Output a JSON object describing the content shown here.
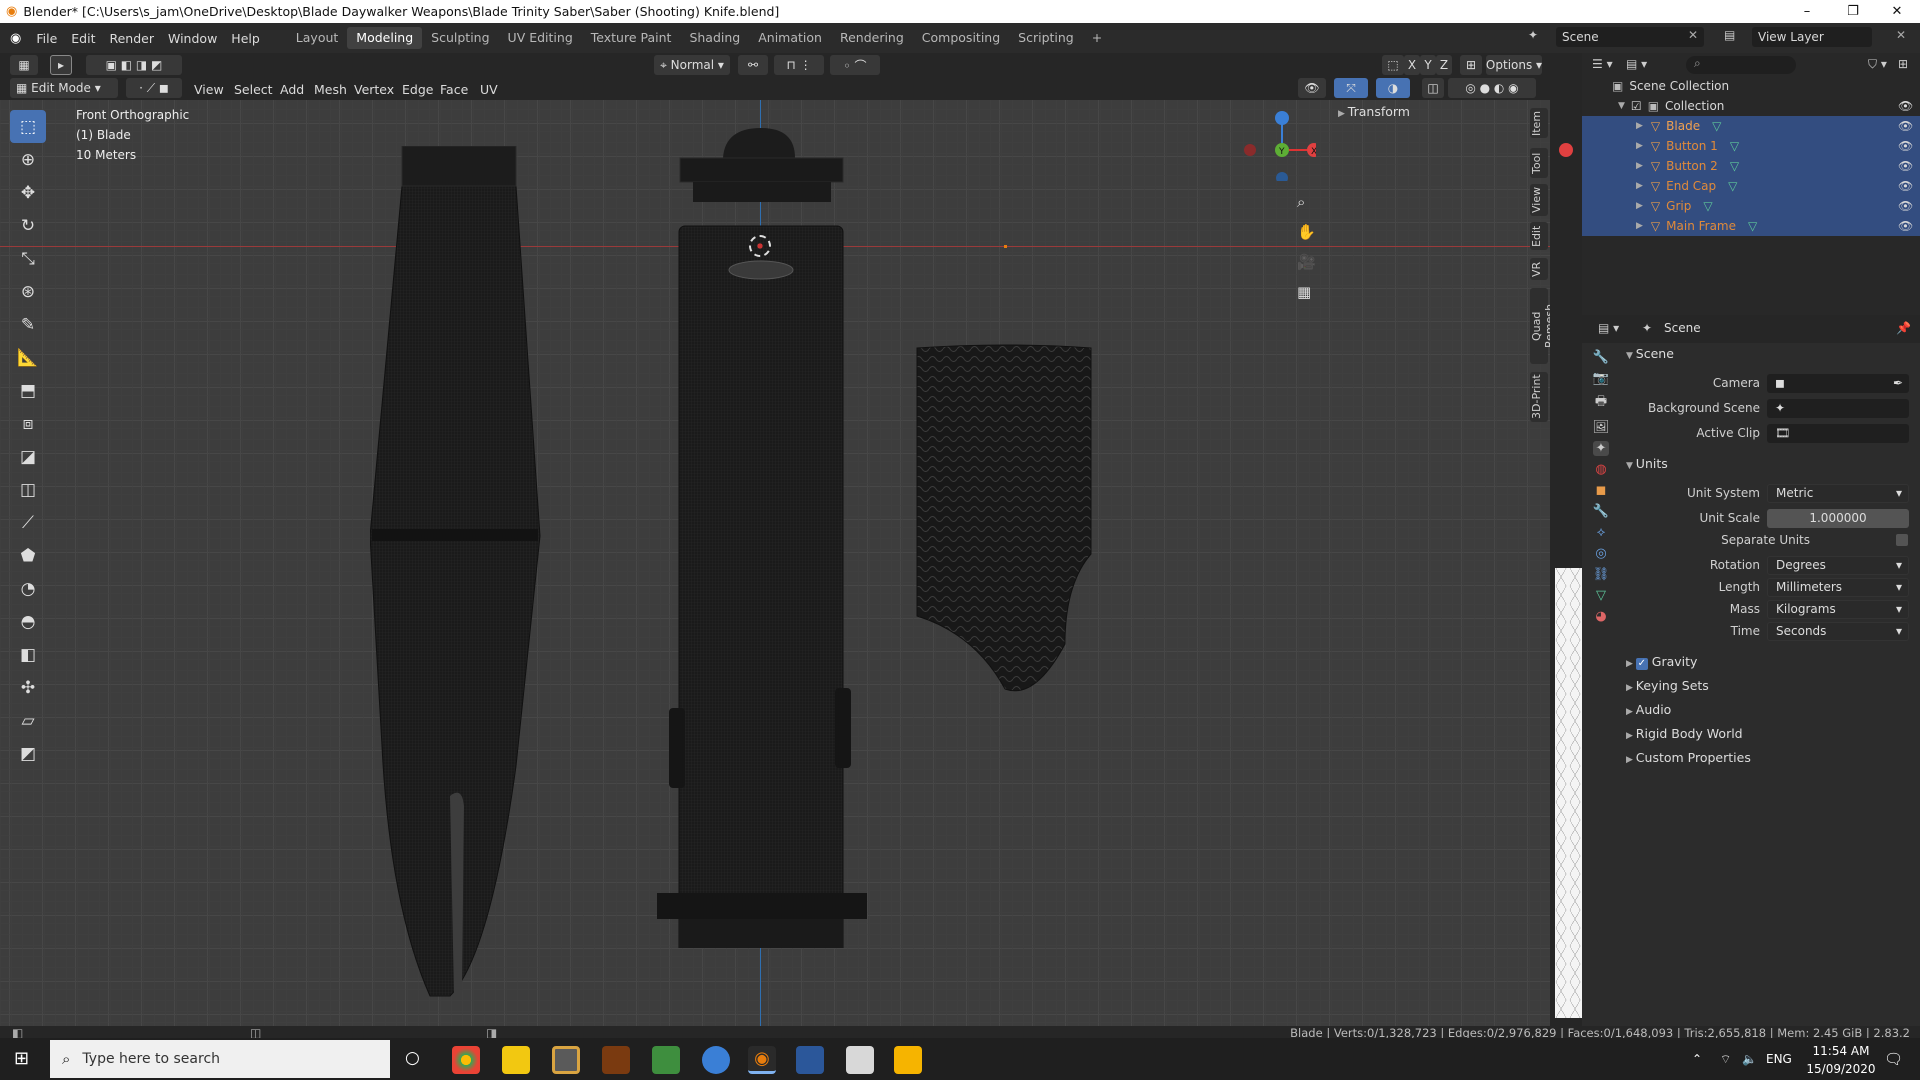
{
  "window": {
    "title": "Blender* [C:\\Users\\s_jam\\OneDrive\\Desktop\\Blade Daywalker Weapons\\Blade Trinity Saber\\Saber (Shooting) Knife.blend]",
    "minimize": "–",
    "maximize": "❐",
    "close": "✕"
  },
  "menu": [
    "File",
    "Edit",
    "Render",
    "Window",
    "Help"
  ],
  "workspaces": [
    "Layout",
    "Modeling",
    "Sculpting",
    "UV Editing",
    "Texture Paint",
    "Shading",
    "Animation",
    "Rendering",
    "Compositing",
    "Scripting",
    "+"
  ],
  "scene": {
    "label": "Scene",
    "view_layer": "View Layer"
  },
  "viewport": {
    "mode": "Edit Mode",
    "menus": [
      "View",
      "Select",
      "Add",
      "Mesh",
      "Vertex",
      "Edge",
      "Face",
      "UV"
    ],
    "orientation": "Normal",
    "axes": [
      "X",
      "Y",
      "Z"
    ],
    "options": "Options",
    "overlay": {
      "view": "Front Orthographic",
      "object": "(1) Blade",
      "scale": "10 Meters"
    },
    "transform_panel": "Transform",
    "side_tabs": [
      "Item",
      "Tool",
      "View",
      "Edit",
      "VR",
      "Quad Remesh",
      "3D-Print"
    ],
    "gizmo": {
      "z": "Z",
      "y": "Y",
      "x": "X"
    },
    "colors": {
      "x_axis": "#8a2b2b",
      "y_axis": "#2f6fb0",
      "selection": "#4772b3"
    }
  },
  "outliner": {
    "root": "Scene Collection",
    "collection": "Collection",
    "items": [
      "Blade",
      "Button 1",
      "Button 2",
      "End Cap",
      "Grip",
      "Main Frame"
    ]
  },
  "properties": {
    "header": "Scene",
    "scene_section": "Scene",
    "camera_label": "Camera",
    "background_label": "Background Scene",
    "clip_label": "Active Clip",
    "units_section": "Units",
    "unit_system_label": "Unit System",
    "unit_system": "Metric",
    "unit_scale_label": "Unit Scale",
    "unit_scale": "1.000000",
    "separate_units": "Separate Units",
    "rotation_label": "Rotation",
    "rotation": "Degrees",
    "length_label": "Length",
    "length": "Millimeters",
    "mass_label": "Mass",
    "mass": "Kilograms",
    "time_label": "Time",
    "time": "Seconds",
    "gravity": "Gravity",
    "sections": [
      "Keying Sets",
      "Audio",
      "Rigid Body World",
      "Custom Properties"
    ]
  },
  "status": "Blade | Verts:0/1,328,723 | Edges:0/2,976,829 | Faces:0/1,648,093 | Tris:2,655,818 | Mem: 2.45 GiB | 2.83.2",
  "taskbar": {
    "search": "Type here to search",
    "lang": "ENG",
    "time": "11:54 AM",
    "date": "15/09/2020"
  }
}
